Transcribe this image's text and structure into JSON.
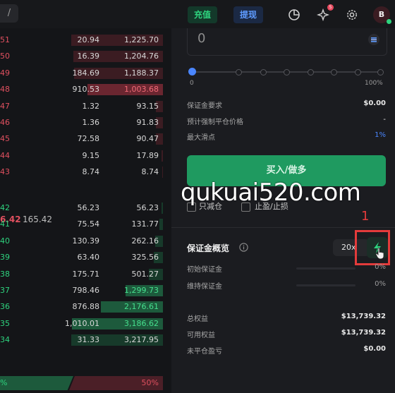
{
  "topbar": {
    "left_tab": "/",
    "deposit_label": "充值",
    "withdraw_label": "提现",
    "icons": [
      "pie-chart-icon",
      "sparkle-icon",
      "gear-icon"
    ],
    "notification_count": "5",
    "avatar_initial": "B"
  },
  "orderbook": {
    "asks": [
      {
        "price": "51",
        "size": "20.94",
        "total": "1,225.70",
        "depth": 1.0
      },
      {
        "price": "50",
        "size": "16.39",
        "total": "1,204.76",
        "depth": 0.98
      },
      {
        "price": "49",
        "size": "184.69",
        "total": "1,188.37",
        "depth": 0.97
      },
      {
        "price": "48",
        "size": "910.53",
        "total": "1,003.68",
        "depth": 0.82,
        "highlight": true
      },
      {
        "price": "47",
        "size": "1.32",
        "total": "93.15",
        "depth": 0.08
      },
      {
        "price": "46",
        "size": "1.36",
        "total": "91.83",
        "depth": 0.075
      },
      {
        "price": "45",
        "size": "72.58",
        "total": "90.47",
        "depth": 0.074
      },
      {
        "price": "44",
        "size": "9.15",
        "total": "17.89",
        "depth": 0.015
      },
      {
        "price": "43",
        "size": "8.74",
        "total": "8.74",
        "depth": 0.007
      }
    ],
    "mid_price": "6.42",
    "mark_price": "165.42",
    "bids": [
      {
        "price": "42",
        "size": "56.23",
        "total": "56.23",
        "depth": 0.018
      },
      {
        "price": "41",
        "size": "75.54",
        "total": "131.77",
        "depth": 0.04
      },
      {
        "price": "40",
        "size": "130.39",
        "total": "262.16",
        "depth": 0.082
      },
      {
        "price": "39",
        "size": "63.40",
        "total": "325.56",
        "depth": 0.1
      },
      {
        "price": "38",
        "size": "175.71",
        "total": "501.27",
        "depth": 0.157
      },
      {
        "price": "37",
        "size": "798.46",
        "total": "1,299.73",
        "depth": 0.41,
        "highlight": true
      },
      {
        "price": "36",
        "size": "876.88",
        "total": "2,176.61",
        "depth": 0.68,
        "highlight": true
      },
      {
        "price": "35",
        "size": "1,010.01",
        "total": "3,186.62",
        "depth": 0.99,
        "highlight": true
      },
      {
        "price": "34",
        "size": "31.33",
        "total": "3,217.95",
        "depth": 1.0
      }
    ],
    "ratio_buy": "%",
    "ratio_sell": "50%"
  },
  "order_form": {
    "amount_value": "0",
    "slider_min": "0",
    "slider_max": "100%",
    "slider_value": 0,
    "margin_required_label": "保证金要求",
    "margin_required_value": "$0.00",
    "liq_price_label": "预计强制平仓价格",
    "liq_price_value": "-",
    "max_slippage_label": "最大滑点",
    "max_slippage_value": "1%",
    "buy_button_label": "买入/做多",
    "reduce_only_label": "只减仓",
    "tp_sl_label": "止盈/止损"
  },
  "overview": {
    "title": "保证金概览",
    "leverage": "20x",
    "initial_margin_label": "初始保证金",
    "initial_margin_pct": "0%",
    "initial_margin_fill": 0,
    "maintenance_margin_label": "维持保证金",
    "maintenance_margin_pct": "0%",
    "maintenance_margin_fill": 0,
    "total_equity_label": "总权益",
    "total_equity_value": "$13,739.32",
    "available_equity_label": "可用权益",
    "available_equity_value": "$13,739.32",
    "unrealized_pnl_label": "未平仓盈亏",
    "unrealized_pnl_value": "$0.00"
  },
  "annotation": {
    "step_number": "1"
  },
  "watermark": "qukuai520.com",
  "colors": {
    "ask": "#e0505f",
    "bid": "#2ed37e",
    "accent": "#4a86ff",
    "buy_button": "#1f9a60",
    "highlight": "#e33b3b"
  }
}
